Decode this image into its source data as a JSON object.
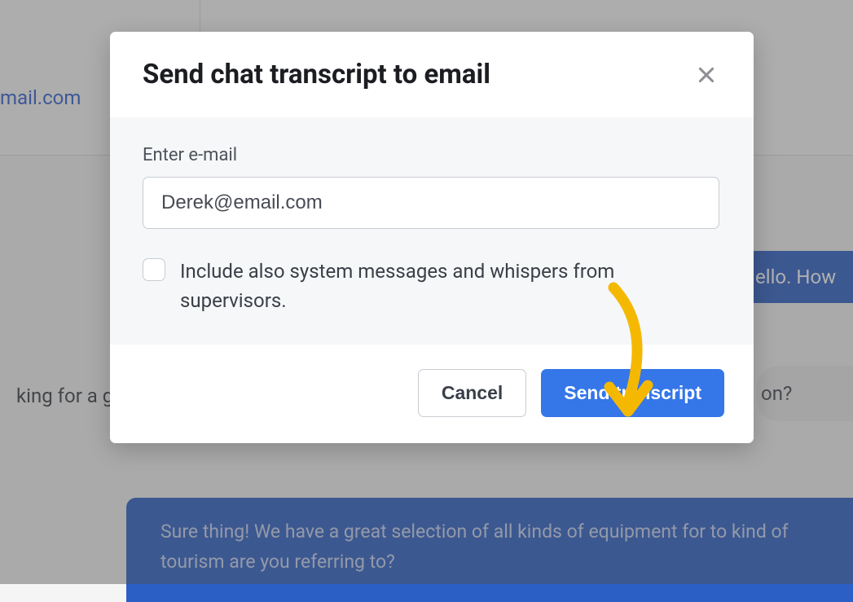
{
  "modal": {
    "title": "Send chat transcript to email",
    "email_label": "Enter e-mail",
    "email_value": "Derek@email.com",
    "checkbox_label": "Include also system messages and whispers from supervisors.",
    "cancel_label": "Cancel",
    "send_label": "Send transcript"
  },
  "background": {
    "email_link": "mail.com",
    "agent_msg_1": "ello. How",
    "user_msg": "king for a g",
    "pill_msg": "on?",
    "agent_msg_2": "Sure thing! We have a great selection of all kinds of equipment for to kind of tourism are you referring to?"
  }
}
